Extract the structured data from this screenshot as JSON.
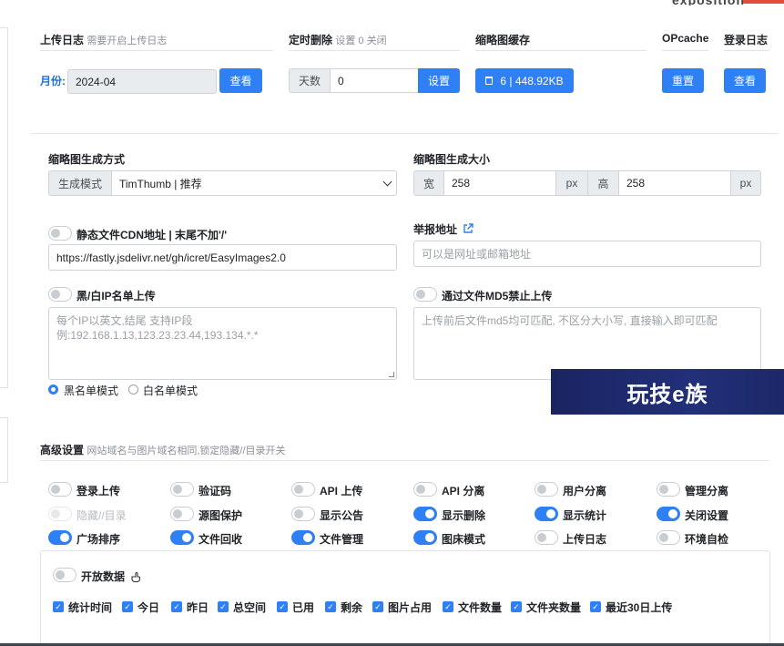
{
  "top_row": {
    "upload_log": {
      "title": "上传日志",
      "hint": "需要开启上传日志",
      "month_label": "月份:",
      "month_value": "2024-04",
      "view_label": "查看"
    },
    "scheduled_delete": {
      "title": "定时删除",
      "hint": "设置 0 关闭",
      "days_addon": "天数",
      "days_value": "0",
      "set_label": "设置"
    },
    "thumb_cache": {
      "title": "缩略图缓存",
      "cache_label": "6 | 448.92KB"
    },
    "opcache": {
      "title": "OPcache",
      "reset_label": "重置"
    },
    "login_log": {
      "title": "登录日志",
      "view_label": "查看"
    }
  },
  "thumbnail": {
    "method_title": "缩略图生成方式",
    "mode_addon": "生成模式",
    "mode_value": "TimThumb | 推荐",
    "size_title": "缩略图生成大小",
    "width_addon": "宽",
    "width_value": "258",
    "height_addon": "高",
    "height_value": "258",
    "unit": "px"
  },
  "cdn": {
    "label": "静态文件CDN地址 | 末尾不加'/'",
    "value": "https://fastly.jsdelivr.net/gh/icret/EasyImages2.0"
  },
  "report": {
    "label": "举报地址",
    "placeholder": "可以是网址或邮箱地址"
  },
  "ip_list": {
    "label": "黑/白IP名单上传",
    "placeholder": "每个IP以英文,结尾 支持IP段 例:192.168.1.13,123.23.23.44,193.134.*.*",
    "blacklist_label": "黑名单模式",
    "whitelist_label": "白名单模式"
  },
  "md5": {
    "label": "通过文件MD5禁止上传",
    "placeholder": "上传前后文件md5均可匹配, 不区分大小写, 直接输入即可匹配"
  },
  "watermark": {
    "text": "玩技e族"
  },
  "advanced": {
    "title": "高级设置",
    "hint": "网站域名与图片域名相同,锁定隐藏//目录开关",
    "toggles": [
      {
        "label": "登录上传",
        "on": false,
        "dim": false
      },
      {
        "label": "验证码",
        "on": false,
        "dim": false
      },
      {
        "label": "API 上传",
        "on": false,
        "dim": false
      },
      {
        "label": "API 分离",
        "on": false,
        "dim": false
      },
      {
        "label": "用户分离",
        "on": false,
        "dim": false
      },
      {
        "label": "管理分离",
        "on": false,
        "dim": false
      },
      {
        "label": "隐藏//目录",
        "on": false,
        "dim": true
      },
      {
        "label": "源图保护",
        "on": false,
        "dim": false
      },
      {
        "label": "显示公告",
        "on": false,
        "dim": false
      },
      {
        "label": "显示删除",
        "on": true,
        "dim": false
      },
      {
        "label": "显示统计",
        "on": true,
        "dim": false
      },
      {
        "label": "关闭设置",
        "on": true,
        "dim": false
      },
      {
        "label": "广场排序",
        "on": true,
        "dim": false
      },
      {
        "label": "文件回收",
        "on": true,
        "dim": false
      },
      {
        "label": "文件管理",
        "on": true,
        "dim": false
      },
      {
        "label": "图床模式",
        "on": true,
        "dim": false
      },
      {
        "label": "上传日志",
        "on": false,
        "dim": false
      },
      {
        "label": "环境自检",
        "on": false,
        "dim": false
      }
    ]
  },
  "open_data": {
    "label": "开放数据",
    "checks": [
      "统计时间",
      "今日",
      "昨日",
      "总空间",
      "已用",
      "剩余",
      "图片占用",
      "文件数量",
      "文件夹数量",
      "最近30日上传"
    ]
  },
  "colors": {
    "primary": "#2f7ff5",
    "accent_label": "#1e6fe0",
    "watermark_bg": "#1c2a6b"
  }
}
